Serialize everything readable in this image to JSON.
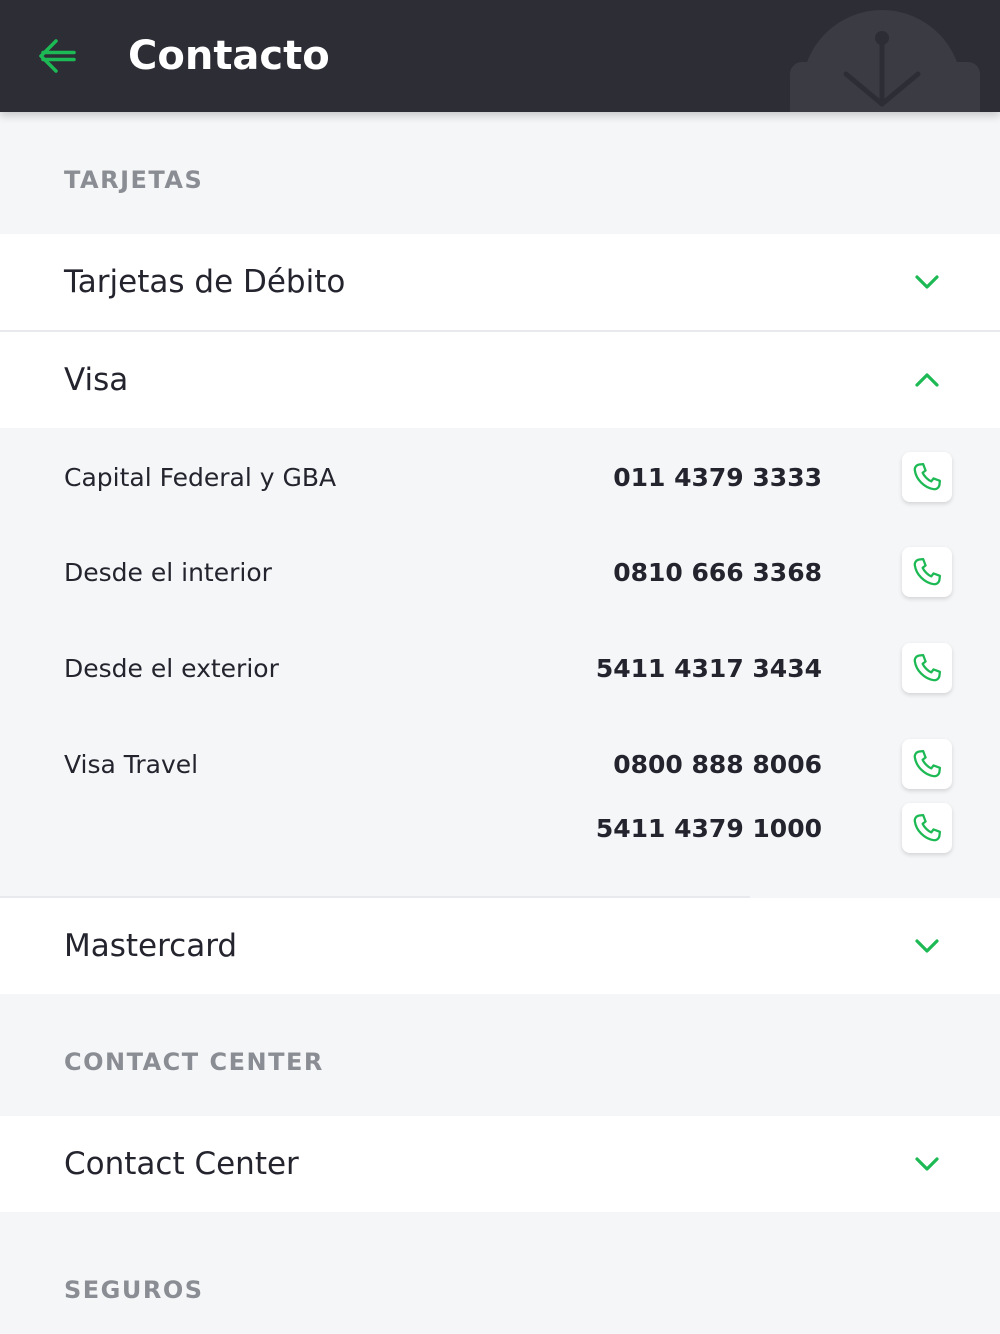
{
  "header": {
    "title": "Contacto"
  },
  "colors": {
    "accent": "#1db954",
    "header_bg": "#2d2d35",
    "page_bg": "#f5f6f8"
  },
  "sections": {
    "tarjetas": {
      "label": "TARJETAS",
      "items": [
        {
          "label": "Tarjetas de Débito",
          "state": "collapsed"
        },
        {
          "label": "Visa",
          "state": "expanded",
          "entries": [
            {
              "label": "Capital Federal y GBA",
              "numbers": [
                "011 4379 3333"
              ]
            },
            {
              "label": "Desde el interior",
              "numbers": [
                "0810 666 3368"
              ]
            },
            {
              "label": "Desde el exterior",
              "numbers": [
                "5411 4317 3434"
              ]
            },
            {
              "label": "Visa Travel",
              "numbers": [
                "0800 888 8006",
                "5411 4379 1000"
              ]
            }
          ]
        },
        {
          "label": "Mastercard",
          "state": "collapsed"
        }
      ]
    },
    "contact_center": {
      "label": "CONTACT CENTER",
      "items": [
        {
          "label": "Contact Center",
          "state": "collapsed"
        }
      ]
    },
    "seguros": {
      "label": "SEGUROS"
    }
  },
  "icons": {
    "back": "arrow-left-icon",
    "collapsed": "chevron-down-icon",
    "expanded": "chevron-up-icon",
    "call": "phone-icon"
  }
}
